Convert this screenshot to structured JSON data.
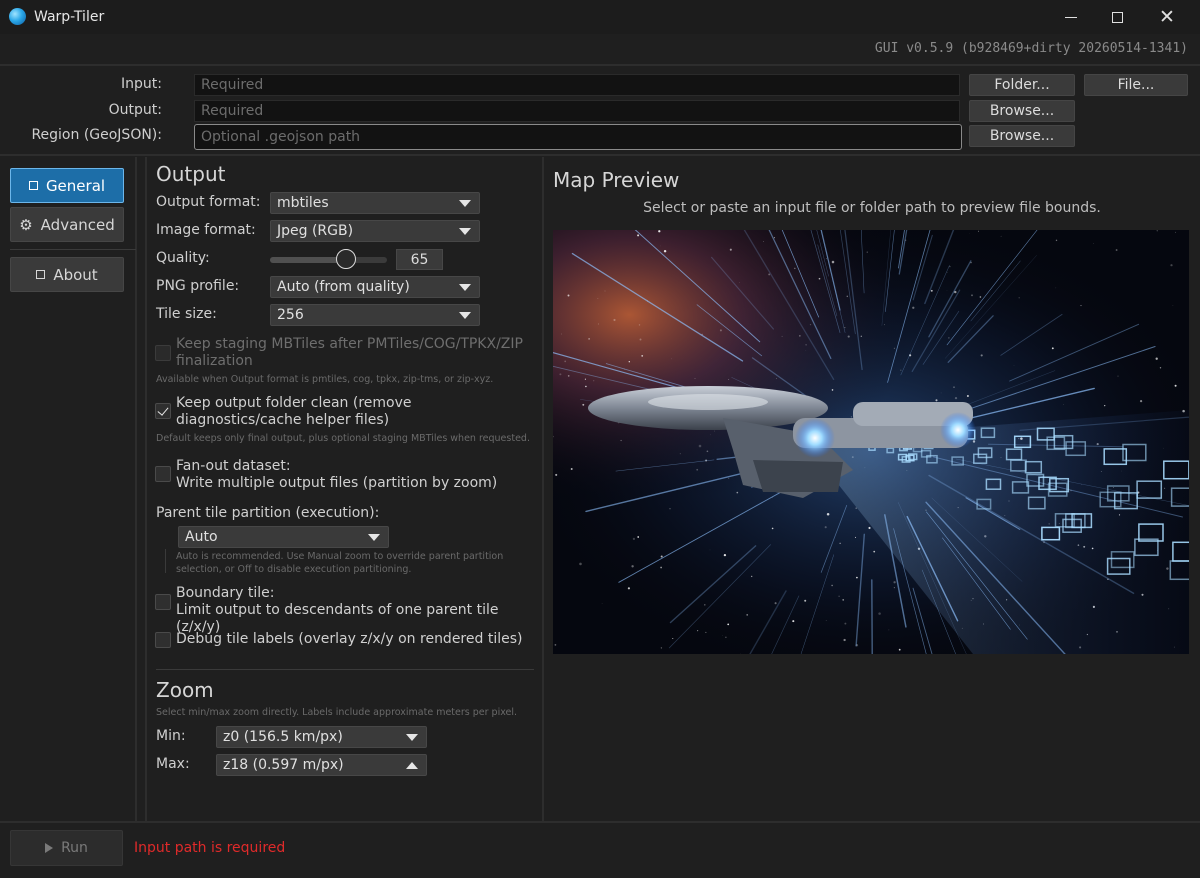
{
  "window": {
    "title": "Warp-Tiler",
    "version": "GUI v0.5.9 (b928469+dirty 20260514-1341)"
  },
  "io": {
    "input_label": "Input:",
    "input_placeholder": "Required",
    "output_label": "Output:",
    "output_placeholder": "Required",
    "region_label": "Region (GeoJSON):",
    "region_placeholder": "Optional .geojson path",
    "folder_button": "Folder...",
    "file_button": "File...",
    "browse_output_button": "Browse...",
    "browse_region_button": "Browse..."
  },
  "sidebar": {
    "items": [
      {
        "label": "General",
        "icon": "square-icon",
        "active": true
      },
      {
        "label": "Advanced",
        "icon": "gear-icon",
        "active": false
      },
      {
        "label": "About",
        "icon": "square-icon",
        "active": false
      }
    ]
  },
  "output": {
    "title": "Output",
    "output_format_label": "Output format:",
    "output_format_value": "mbtiles",
    "image_format_label": "Image format:",
    "image_format_value": "Jpeg (RGB)",
    "quality_label": "Quality:",
    "quality_value": "65",
    "quality_level": 0.65,
    "png_profile_label": "PNG profile:",
    "png_profile_value": "Auto (from quality)",
    "tile_size_label": "Tile size:",
    "tile_size_value": "256",
    "keep_staging_label": "Keep staging MBTiles after PMTiles/COG/TPKX/ZIP finalization",
    "keep_staging_checked": false,
    "keep_staging_hint": "Available when Output format is pmtiles, cog, tpkx, zip-tms, or zip-xyz.",
    "keep_clean_label": "Keep output folder clean (remove diagnostics/cache helper files)",
    "keep_clean_checked": true,
    "keep_clean_hint": "Default keeps only final output, plus optional staging MBTiles when requested.",
    "fanout_label_1": "Fan-out dataset:",
    "fanout_label_2": "Write multiple output files (partition by zoom)",
    "fanout_checked": false,
    "parent_partition_label": "Parent tile partition (execution):",
    "parent_partition_value": "Auto",
    "parent_partition_hint": "Auto is recommended. Use Manual zoom to override parent partition selection, or Off to disable execution partitioning.",
    "boundary_label_1": "Boundary tile:",
    "boundary_label_2": "Limit output to descendants of one parent tile (z/x/y)",
    "boundary_checked": false,
    "debug_label": "Debug tile labels (overlay z/x/y on rendered tiles)",
    "debug_checked": false
  },
  "zoom": {
    "title": "Zoom",
    "hint": "Select min/max zoom directly. Labels include approximate meters per pixel.",
    "min_label": "Min:",
    "min_value": "z0 (156.5 km/px)",
    "max_label": "Max:",
    "max_value": "z18 (0.597 m/px)"
  },
  "preview": {
    "title": "Map Preview",
    "message": "Select or paste an input file or folder path to preview file bounds."
  },
  "run": {
    "label": "Run",
    "error": "Input path is required"
  },
  "colors": {
    "accent": "#1d6ea8",
    "error": "#e02a2a",
    "background": "#1f1f1f"
  }
}
